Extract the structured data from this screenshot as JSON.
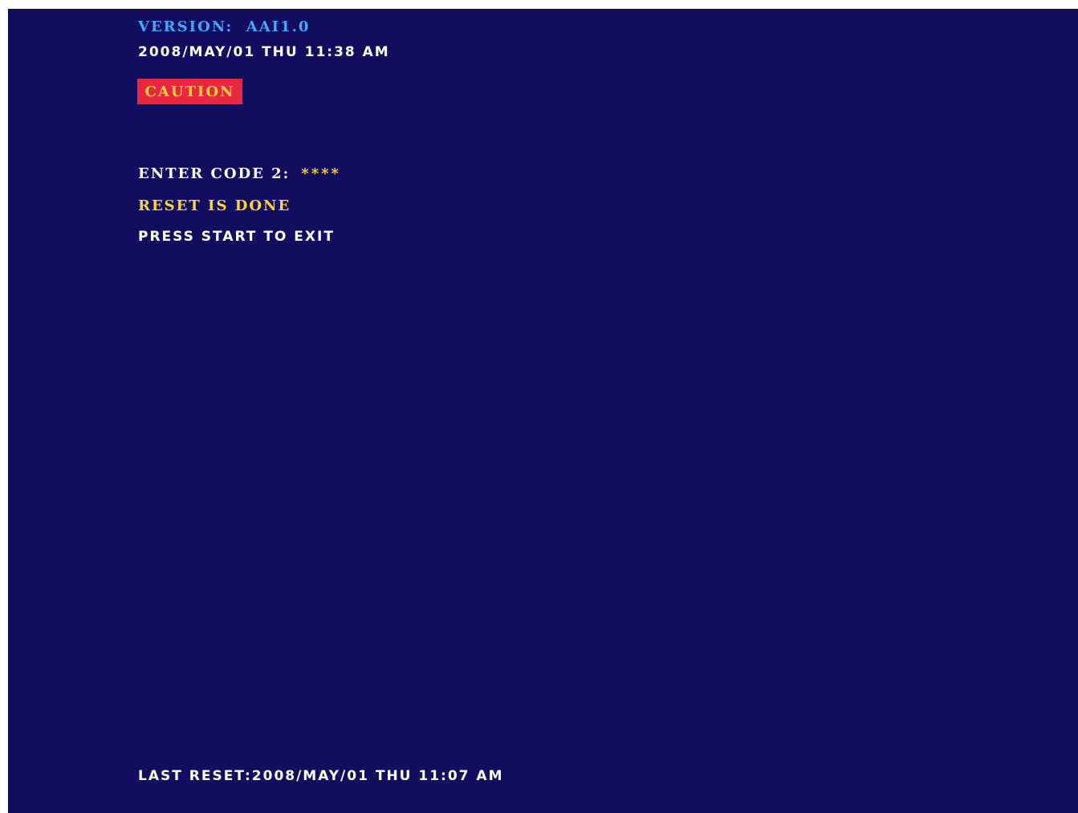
{
  "screen": {
    "version_label": "VERSION:",
    "version_value": "AAI1.0",
    "datetime": "2008/MAY/01 THU 11:38 AM",
    "caution": "CAUTION",
    "enter_code_label": "ENTER CODE 2:",
    "enter_code_value": "****",
    "reset_status": "RESET IS DONE",
    "exit_hint": "PRESS START TO EXIT",
    "last_reset_label": "LAST RESET:",
    "last_reset_value": "2008/MAY/01 THU 11:07 AM"
  },
  "colors": {
    "background": "#120d5e",
    "version_text": "#3fa8ff",
    "caution_bg": "#e8263e",
    "caution_text": "#ffd43a",
    "highlight_text": "#ffd43a",
    "normal_text": "#ffffff"
  }
}
